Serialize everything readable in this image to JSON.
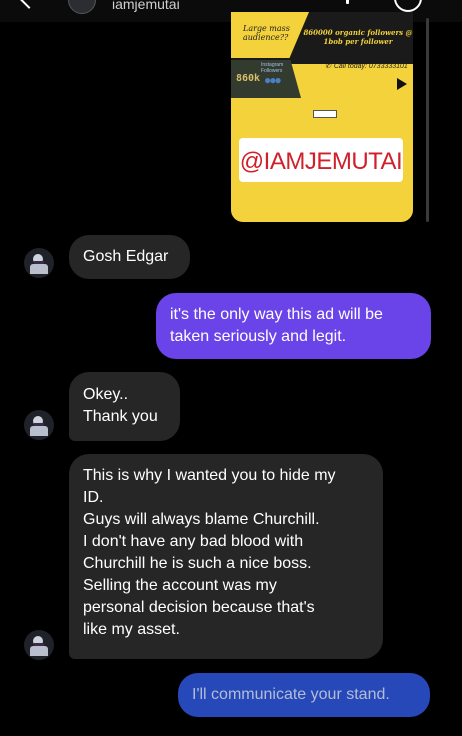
{
  "header": {
    "username": "iamjemutai"
  },
  "ad": {
    "question": "Large mass audience??",
    "headline": "860000 organic followers @ 1bob per follower",
    "phone": "Call today: 0733333101",
    "follower_label": "Instagram Followers",
    "count": "860k",
    "handle": "@IAMJEMUTAI"
  },
  "messages": [
    {
      "sender": "them",
      "lines": [
        "Gosh Edgar"
      ]
    },
    {
      "sender": "me",
      "lines": [
        "it's the only way this ad will be",
        "taken seriously and legit."
      ]
    },
    {
      "sender": "them",
      "lines": [
        "Okey..",
        "Thank you"
      ]
    },
    {
      "sender": "them",
      "lines": [
        "This is why I wanted you to hide my",
        "ID.",
        "Guys will always blame Churchill.",
        "I don't have any bad blood with",
        "Churchill he is such a nice boss.",
        "Selling the account was my",
        "personal decision because that's",
        "like my asset."
      ]
    },
    {
      "sender": "me",
      "lines": [
        "I'll communicate your stand."
      ]
    }
  ],
  "colors": {
    "background": "#000000",
    "incoming_bubble": "#262626",
    "outgoing_bubble": "#6a44e9",
    "outgoing_bubble_latest": "#2748b8",
    "ad_yellow": "#f3d23c",
    "handle_red": "#d0202a"
  }
}
